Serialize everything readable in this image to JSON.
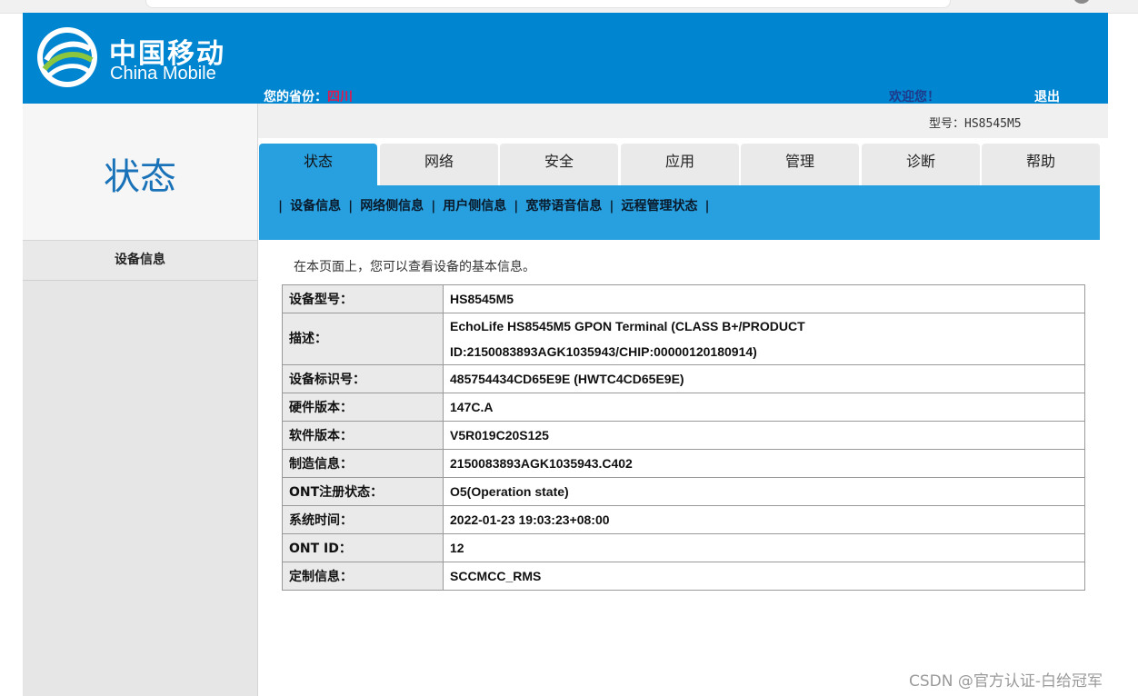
{
  "header": {
    "logo_cn": "中国移动",
    "logo_en": "China Mobile",
    "province_label": "您的省份：",
    "province_value": "四川",
    "welcome": "欢迎您！",
    "logout": "退出",
    "bg_color": "#0085d0"
  },
  "model": {
    "label": "型号：",
    "value": "HS8545M5"
  },
  "sidebar": {
    "title": "状态",
    "items": [
      "设备信息"
    ]
  },
  "tabs": [
    {
      "label": "状态",
      "active": true
    },
    {
      "label": "网络"
    },
    {
      "label": "安全"
    },
    {
      "label": "应用"
    },
    {
      "label": "管理"
    },
    {
      "label": "诊断"
    },
    {
      "label": "帮助"
    }
  ],
  "subnav": [
    "设备信息",
    "网络侧信息",
    "用户侧信息",
    "宽带语音信息",
    "远程管理状态"
  ],
  "intro": "在本页面上，您可以查看设备的基本信息。",
  "device_info": [
    {
      "key": "设备型号：",
      "value": "HS8545M5"
    },
    {
      "key": "描述：",
      "value": "EchoLife HS8545M5 GPON Terminal (CLASS B+/PRODUCT ID:2150083893AGK1035943/CHIP:00000120180914)"
    },
    {
      "key": "设备标识号：",
      "value": "485754434CD65E9E (HWTC4CD65E9E)"
    },
    {
      "key": "硬件版本：",
      "value": "147C.A"
    },
    {
      "key": "软件版本：",
      "value": "V5R019C20S125"
    },
    {
      "key": "制造信息：",
      "value": "2150083893AGK1035943.C402"
    },
    {
      "key": "ONT注册状态：",
      "value": "O5(Operation state)"
    },
    {
      "key": "系统时间：",
      "value": "2022-01-23 19:03:23+08:00"
    },
    {
      "key": "ONT ID：",
      "value": "12"
    },
    {
      "key": "定制信息：",
      "value": "SCCMCC_RMS"
    }
  ],
  "watermark": "CSDN @官方认证-白给冠军"
}
